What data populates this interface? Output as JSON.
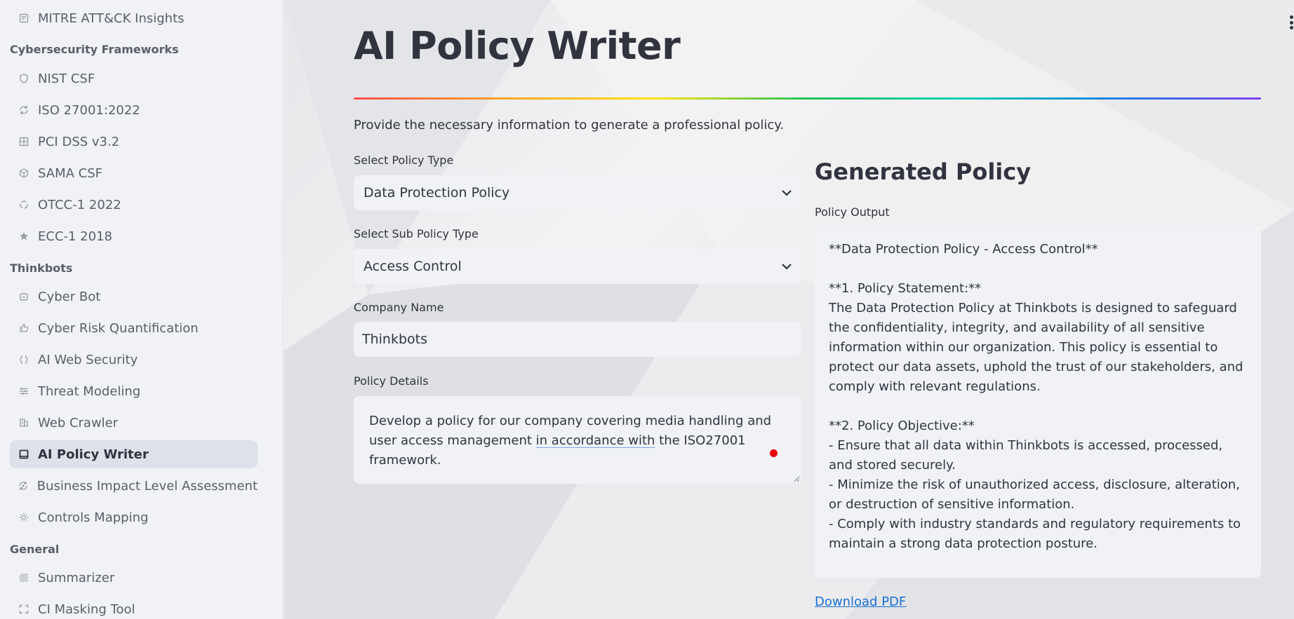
{
  "sidebar": {
    "items_top": [
      {
        "label": "MITRE ATT&CK Insights",
        "icon": "report-icon"
      }
    ],
    "sections": [
      {
        "title": "Cybersecurity Frameworks",
        "items": [
          {
            "label": "NIST CSF",
            "icon": "shield-icon"
          },
          {
            "label": "ISO 27001:2022",
            "icon": "sync-icon"
          },
          {
            "label": "PCI DSS v3.2",
            "icon": "grid-icon"
          },
          {
            "label": "SAMA CSF",
            "icon": "cube-icon"
          },
          {
            "label": "OTCC-1 2022",
            "icon": "cycle-icon"
          },
          {
            "label": "ECC-1 2018",
            "icon": "star-icon"
          }
        ]
      },
      {
        "title": "Thinkbots",
        "items": [
          {
            "label": "Cyber Bot",
            "icon": "bot-icon"
          },
          {
            "label": "Cyber Risk Quantification",
            "icon": "thumb-icon"
          },
          {
            "label": "AI Web Security",
            "icon": "braces-icon"
          },
          {
            "label": "Threat Modeling",
            "icon": "sliders-icon"
          },
          {
            "label": "Web Crawler",
            "icon": "building-icon"
          },
          {
            "label": "AI Policy Writer",
            "icon": "square-icon",
            "active": true
          },
          {
            "label": "Business Impact Level Assessment",
            "icon": "refresh-icon"
          },
          {
            "label": "Controls Mapping",
            "icon": "sun-icon"
          }
        ]
      },
      {
        "title": "General",
        "items": [
          {
            "label": "Summarizer",
            "icon": "hatch-icon"
          },
          {
            "label": "CI Masking Tool",
            "icon": "frame-icon"
          }
        ]
      }
    ]
  },
  "main": {
    "title": "AI Policy Writer",
    "intro": "Provide the necessary information to generate a professional policy.",
    "policy_type": {
      "label": "Select Policy Type",
      "value": "Data Protection Policy"
    },
    "sub_policy_type": {
      "label": "Select Sub Policy Type",
      "value": "Access Control"
    },
    "company_name": {
      "label": "Company Name",
      "value": "Thinkbots"
    },
    "policy_details": {
      "label": "Policy Details",
      "text_before": "Develop a policy for our company covering media handling and user access management ",
      "text_spell": "in accordance with",
      "text_after": " the ISO27001 framework."
    },
    "generated": {
      "title": "Generated Policy",
      "output_label": "Policy Output",
      "output_text": "**Data Protection Policy - Access Control**\n\n**1. Policy Statement:**\nThe Data Protection Policy at Thinkbots is designed to safeguard the confidentiality, integrity, and availability of all sensitive information within our organization. This policy is essential to protect our data assets, uphold the trust of our stakeholders, and comply with relevant regulations.\n\n**2. Policy Objective:**\n- Ensure that all data within Thinkbots is accessed, processed, and stored securely.\n- Minimize the risk of unauthorized access, disclosure, alteration, or destruction of sensitive information.\n- Comply with industry standards and regulatory requirements to maintain a strong data protection posture.",
      "download_label": "Download PDF"
    }
  }
}
